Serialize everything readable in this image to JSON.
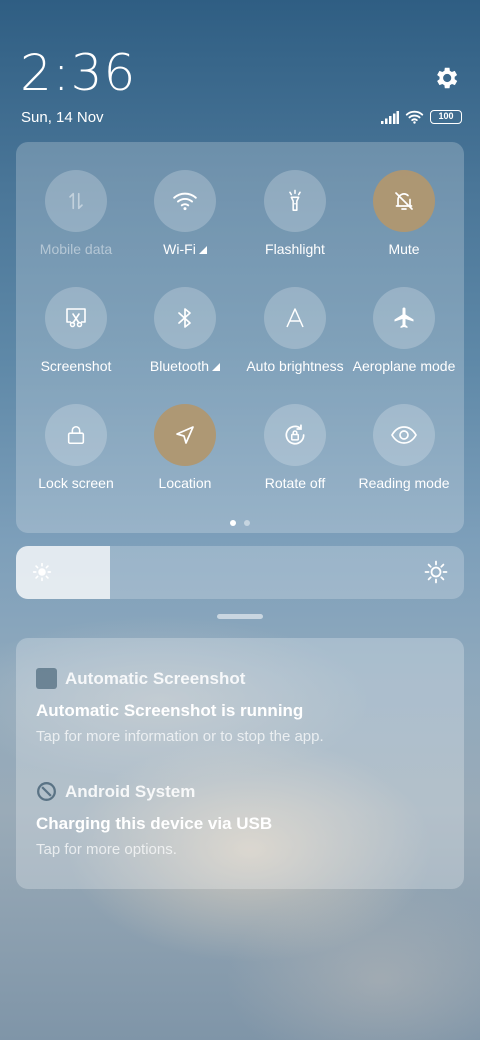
{
  "status": {
    "time": "2:36",
    "date": "Sun, 14 Nov",
    "battery": "100"
  },
  "quick_settings": {
    "tiles": [
      {
        "label": "Mobile data",
        "icon": "mobile-data-icon",
        "active": false,
        "disabled": true
      },
      {
        "label": "Wi-Fi",
        "icon": "wifi-icon",
        "active": false,
        "expandable": true
      },
      {
        "label": "Flashlight",
        "icon": "flashlight-icon",
        "active": false
      },
      {
        "label": "Mute",
        "icon": "bell-off-icon",
        "active": true
      },
      {
        "label": "Screenshot",
        "icon": "screenshot-icon",
        "active": false
      },
      {
        "label": "Bluetooth",
        "icon": "bluetooth-icon",
        "active": false,
        "expandable": true
      },
      {
        "label": "Auto brightness",
        "icon": "auto-brightness-icon",
        "active": false
      },
      {
        "label": "Aeroplane mode",
        "icon": "airplane-icon",
        "active": false
      },
      {
        "label": "Lock screen",
        "icon": "lock-icon",
        "active": false
      },
      {
        "label": "Location",
        "icon": "location-icon",
        "active": true
      },
      {
        "label": "Rotate off",
        "icon": "rotate-lock-icon",
        "active": false
      },
      {
        "label": "Reading mode",
        "icon": "eye-icon",
        "active": false
      }
    ],
    "page": 1,
    "page_count": 2
  },
  "brightness": {
    "level": 0.21
  },
  "notifications": [
    {
      "app": "Automatic Screenshot",
      "title": "Automatic Screenshot is running",
      "body": "Tap for more information or to stop the app."
    },
    {
      "app": "Android System",
      "title": "Charging this device via USB",
      "body": "Tap for more options."
    }
  ],
  "colors": {
    "active_tile": "#b09770"
  }
}
